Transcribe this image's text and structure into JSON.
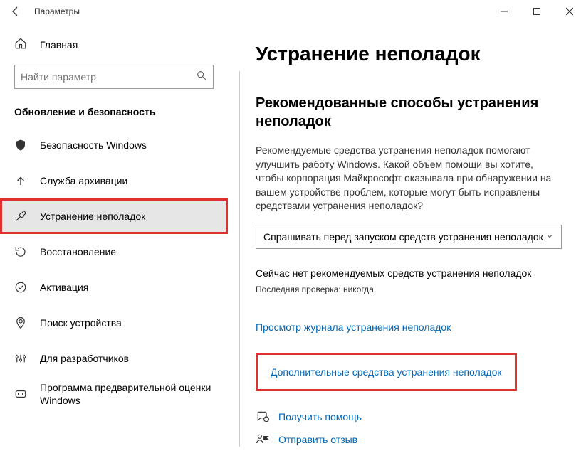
{
  "window": {
    "title": "Параметры"
  },
  "sidebar": {
    "home_label": "Главная",
    "search_placeholder": "Найти параметр",
    "section_label": "Обновление и безопасность",
    "items": [
      {
        "label": "Безопасность Windows"
      },
      {
        "label": "Служба архивации"
      },
      {
        "label": "Устранение неполадок"
      },
      {
        "label": "Восстановление"
      },
      {
        "label": "Активация"
      },
      {
        "label": "Поиск устройства"
      },
      {
        "label": "Для разработчиков"
      },
      {
        "label": "Программа предварительной оценки Windows"
      }
    ]
  },
  "main": {
    "page_title": "Устранение неполадок",
    "subheader": "Рекомендованные способы устранения неполадок",
    "desc": "Рекомендуемые средства устранения неполадок помогают улучшить работу Windows. Какой объем помощи вы хотите, чтобы корпорация Майкрософт оказывала при обнаружении на вашем устройстве проблем, которые могут быть исправлены средствами устранения неполадок?",
    "dropdown_value": "Спрашивать перед запуском средств устранения неполадок",
    "status": "Сейчас нет рекомендуемых средств устранения неполадок",
    "last_check": "Последняя проверка: никогда",
    "link_history": "Просмотр журнала устранения неполадок",
    "link_additional": "Дополнительные средства устранения неполадок",
    "link_help": "Получить помощь",
    "link_feedback": "Отправить отзыв"
  }
}
